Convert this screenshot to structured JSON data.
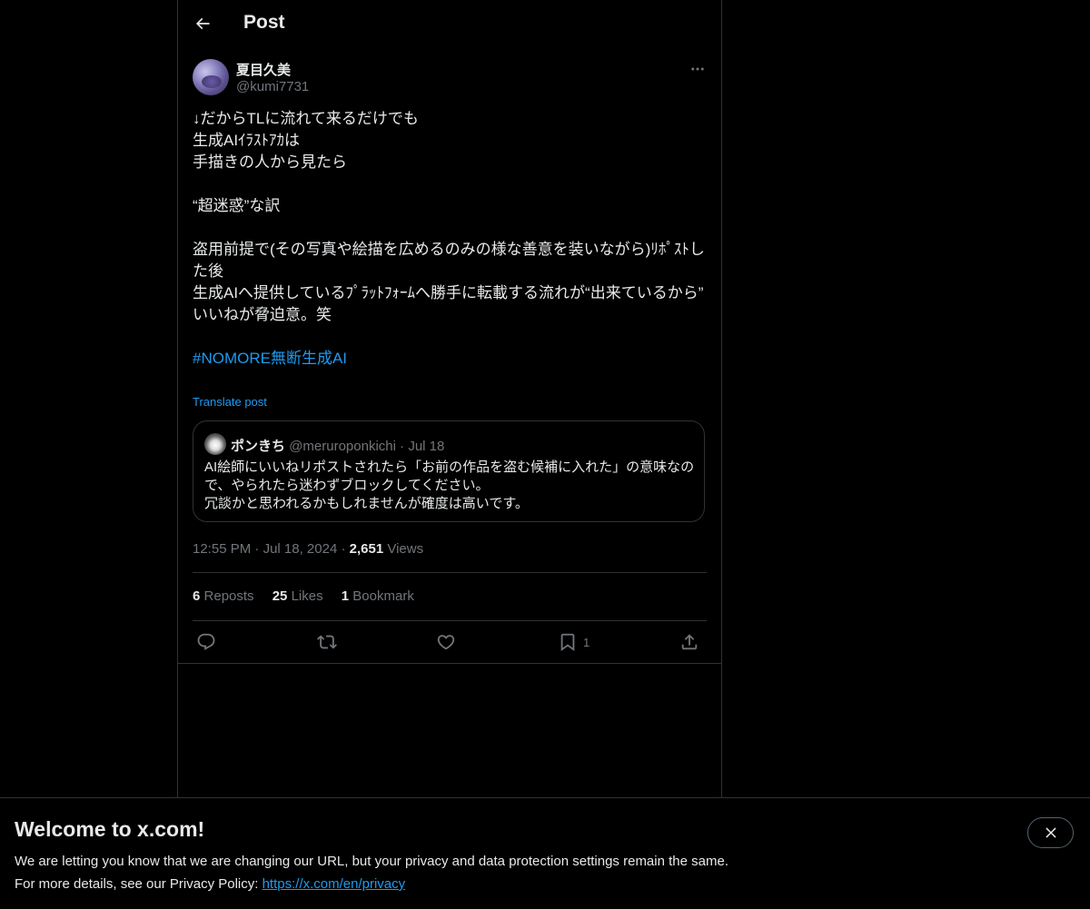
{
  "header": {
    "title": "Post"
  },
  "post": {
    "author_name": "夏目久美",
    "author_handle": "@kumi7731",
    "text_lines": [
      "↓だからTLに流れて来るだけでも",
      "生成AIｲﾗｽﾄｱｶは",
      "手描きの人から見たら",
      "",
      "“超迷惑”な訳",
      "",
      "盗用前提で(その写真や絵描を広めるのみの様な善意を装いながら)ﾘﾎﾟｽﾄした後",
      "生成AIへ提供しているﾌﾟﾗｯﾄﾌｫｰﾑへ勝手に転載する流れが“出来ているから”",
      "いいねが脅迫意。笑",
      ""
    ],
    "hashtag": "#NOMORE無断生成AI",
    "translate_label": "Translate post",
    "quote": {
      "name": "ポンきち",
      "handle": "@meruroponkichi",
      "separator": "·",
      "date": "Jul 18",
      "text_lines": [
        "AI絵師にいいねリポストされたら「お前の作品を盗む候補に入れた」の意味なので、やられたら迷わずブロックしてください。",
        "冗談かと思われるかもしれませんが確度は高いです。"
      ]
    },
    "time": "12:55 PM",
    "separator": "·",
    "date": "Jul 18, 2024",
    "views_count": "2,651",
    "views_label": "Views",
    "stats": {
      "reposts_count": "6",
      "reposts_label": "Reposts",
      "likes_count": "25",
      "likes_label": "Likes",
      "bookmarks_count": "1",
      "bookmarks_label": "Bookmark"
    },
    "actions": {
      "bookmark_count": "1"
    }
  },
  "banner": {
    "title": "Welcome to x.com!",
    "line1": "We are letting you know that we are changing our URL, but your privacy and data protection settings remain the same.",
    "line2_prefix": "For more details, see our Privacy Policy: ",
    "link": "https://x.com/en/privacy"
  },
  "colors": {
    "accent": "#1d9bf0",
    "background": "#000000",
    "secondary_text": "#71767b",
    "border": "#2f3336"
  },
  "icons": [
    "back-arrow-icon",
    "more-icon",
    "reply-icon",
    "repost-icon",
    "like-icon",
    "bookmark-icon",
    "share-icon",
    "close-icon"
  ]
}
